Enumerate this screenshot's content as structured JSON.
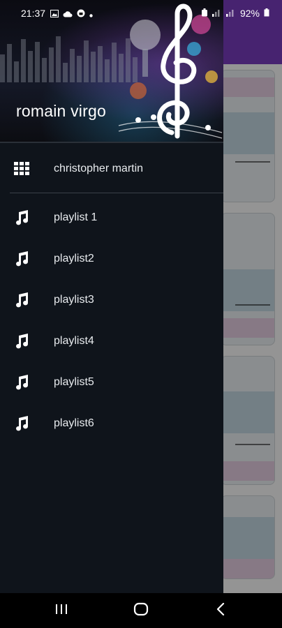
{
  "status_bar": {
    "time": "21:37",
    "battery": "92%",
    "icons_left": [
      "image-icon",
      "cloud-icon",
      "vpn-icon",
      "dot-icon"
    ],
    "icons_right": [
      "alarm-icon",
      "signal-icon",
      "signal-icon",
      "battery-icon"
    ]
  },
  "drawer": {
    "header_title": "romain virgo",
    "top_item": {
      "label": "christopher martin",
      "icon": "grid-icon"
    },
    "playlists": [
      {
        "label": "playlist 1",
        "icon": "music-note-icon"
      },
      {
        "label": "playlist2",
        "icon": "music-note-icon"
      },
      {
        "label": "playlist3",
        "icon": "music-note-icon"
      },
      {
        "label": "playlist4",
        "icon": "music-note-icon"
      },
      {
        "label": "playlist5",
        "icon": "music-note-icon"
      },
      {
        "label": "playlist6",
        "icon": "music-note-icon"
      }
    ]
  },
  "nav_bar": {
    "buttons": [
      "recents-icon",
      "home-icon",
      "back-icon"
    ]
  },
  "colors": {
    "drawer_bg": "#0f141b",
    "app_bar": "#7a3dc2",
    "text": "#e9ecef"
  }
}
